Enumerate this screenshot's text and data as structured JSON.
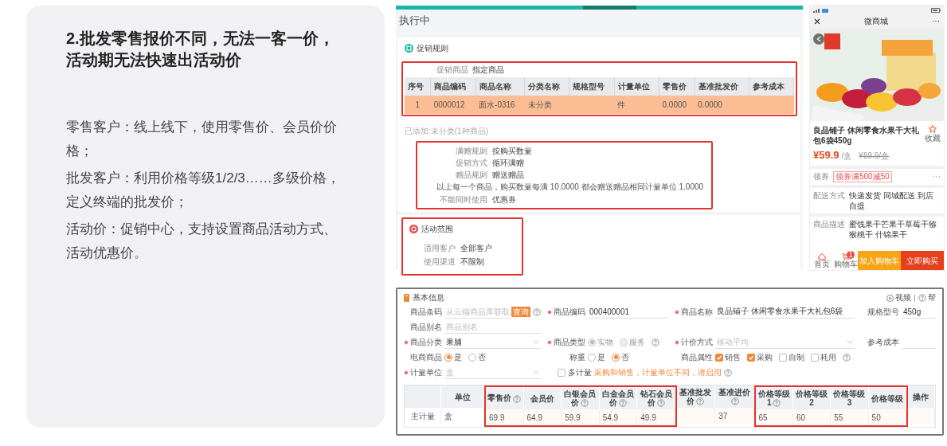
{
  "slide": {
    "title_lines": [
      "2.批发零售报价不同，无法一客一价，",
      "活动期无法快速出活动价"
    ],
    "paragraphs": [
      "零售客户：线上线下，使用零售价、会员价价格；",
      "批发客户：利用价格等级1/2/3……多级价格，定义终端的批发价；",
      "活动价：促销中心，支持设置商品活动方式、活动优惠价。"
    ]
  },
  "promo_screen": {
    "status": "执行中",
    "rule_section": {
      "title": "促销规则",
      "highlighted": true,
      "field": {
        "label": "促销商品",
        "value": "指定商品"
      },
      "columns": [
        "序号",
        "商品编码",
        "商品名称",
        "分类名称",
        "规格型号",
        "计量单位",
        "零售价",
        "基准批发价",
        "参考成本"
      ],
      "rows": [
        {
          "selected": true,
          "cells": [
            "1",
            "0000012",
            "面水-0316",
            "未分类",
            null,
            "件",
            "0.0000",
            "0.0000",
            null
          ]
        }
      ]
    },
    "added_note": "已添加:未分类(1种商品)",
    "rule_box": {
      "highlighted": true,
      "lines": [
        {
          "kind": "field",
          "label": "满赠规则",
          "value": "按购买数量"
        },
        {
          "kind": "field",
          "label": "促销方式",
          "value": "循环满赠"
        },
        {
          "kind": "field",
          "label": "赠品规则",
          "value": "赠送赠品"
        },
        {
          "kind": "sentence",
          "text": "以上每一个商品，购买数量每满 10.0000 都会赠送赠品相同计量单位 1.0000"
        },
        {
          "kind": "field",
          "label": "不能同时使用",
          "value": "优惠券"
        }
      ]
    },
    "scope_section": {
      "title": "活动范围",
      "highlighted": true,
      "fields": [
        {
          "label": "适用客户",
          "value": "全部客户"
        },
        {
          "label": "使用渠道",
          "value": "不限制"
        }
      ]
    }
  },
  "phone": {
    "title": "微商城",
    "menu": "···",
    "product_name": "良品铺子 休闲零食水果干大礼包6袋450g",
    "favorite": "收藏",
    "price": "¥59.9",
    "price_unit": "/盒",
    "old_price": "¥89.9/盒",
    "coupon": {
      "label": "领券",
      "tag": "领券满500减50",
      "more": "···"
    },
    "delivery": {
      "label": "配送方式",
      "value": "快递发货 同城配送 到店自提"
    },
    "description": {
      "label": "商品描述",
      "value": "蜜饯果干芒果干草莓干猕猴桃干 什锦果干"
    },
    "nav": [
      {
        "kind": "home",
        "label": "首页"
      },
      {
        "kind": "cart",
        "label": "购物车",
        "badge": "1"
      }
    ],
    "buttons": [
      {
        "kind": "cart",
        "label": "加入购物车"
      },
      {
        "kind": "buy",
        "label": "立即购买"
      }
    ]
  },
  "product_form": {
    "title": "基本信息",
    "links": [
      {
        "kind": "video",
        "label": "视频"
      },
      {
        "kind": "help",
        "label": "帮"
      }
    ],
    "rows": [
      [
        {
          "kind": "text",
          "label": "商品条码",
          "required": false,
          "help": true,
          "placeholder": "从云端商品库获取",
          "button": "查询"
        },
        {
          "kind": "text",
          "label": "商品编码",
          "required": true,
          "help": false,
          "value": "000400001"
        },
        {
          "kind": "text",
          "label": "商品名称",
          "required": true,
          "help": false,
          "value": "良品铺子 休闲零食水果干大礼包6袋"
        },
        {
          "kind": "text",
          "label": "规格型号",
          "required": false,
          "help": false,
          "value": "450g"
        }
      ],
      [
        {
          "kind": "text",
          "label": "商品别名",
          "required": false,
          "help": false,
          "placeholder": "商品别名"
        }
      ],
      [
        {
          "kind": "select",
          "label": "商品分类",
          "required": true,
          "help": false,
          "disabled": false,
          "value": "果脯"
        },
        {
          "kind": "radio",
          "label": "商品类型",
          "required": true,
          "help": true,
          "disabled": true,
          "options": [
            {
              "label": "实物",
              "selected": true
            },
            {
              "label": "服务",
              "selected": false
            }
          ]
        },
        {
          "kind": "select",
          "label": "计价方式",
          "required": true,
          "help": false,
          "disabled": false,
          "placeholder": "移动平均"
        },
        {
          "kind": "text",
          "label": "参考成本",
          "required": false,
          "help": false
        }
      ],
      [
        {
          "kind": "radio",
          "label": "电商商品",
          "required": false,
          "help": false,
          "disabled": false,
          "options": [
            {
              "label": "是",
              "selected": true
            },
            {
              "label": "否",
              "selected": false
            }
          ]
        },
        {
          "kind": "radio",
          "label": "称重",
          "required": false,
          "help": false,
          "disabled": false,
          "options": [
            {
              "label": "是",
              "selected": false
            },
            {
              "label": "否",
              "selected": true
            }
          ]
        },
        {
          "kind": "checks",
          "label": "商品属性",
          "required": false,
          "help": true,
          "options": [
            {
              "label": "销售",
              "checked": true
            },
            {
              "label": "采购",
              "checked": true
            },
            {
              "label": "自制",
              "checked": false
            },
            {
              "label": "耗用",
              "checked": false
            }
          ]
        }
      ],
      [
        {
          "kind": "select",
          "label": "计量单位",
          "required": true,
          "help": false,
          "disabled": true,
          "value": "盒"
        },
        {
          "kind": "checkbox",
          "label": "多计量",
          "checked": false,
          "wide": true,
          "help": true,
          "note": "采购和销售，计量单位不同，请启用"
        }
      ]
    ],
    "table": {
      "columns": [
        {
          "help": false,
          "highlighted": false
        },
        {
          "label": "单位",
          "help": false,
          "highlighted": false
        },
        {
          "label": "零售价",
          "help": true,
          "highlighted": true
        },
        {
          "label": "会员价",
          "help": false,
          "highlighted": true
        },
        {
          "label": "白银会员价",
          "help": true,
          "highlighted": true
        },
        {
          "label": "白金会员价",
          "help": true,
          "highlighted": true
        },
        {
          "label": "钻石会员价",
          "help": true,
          "highlighted": true
        },
        {
          "label": "基准批发价",
          "help": true,
          "highlighted": false
        },
        {
          "label": "基准进价",
          "help": true,
          "highlighted": false
        },
        {
          "label": "价格等级1",
          "help": true,
          "highlighted": true
        },
        {
          "label": "价格等级2",
          "help": false,
          "highlighted": true
        },
        {
          "label": "价格等级3",
          "help": false,
          "highlighted": true
        },
        {
          "label": "价格等级",
          "help": false,
          "highlighted": true
        },
        {
          "label": "操作",
          "help": false,
          "highlighted": false
        }
      ],
      "rows": [
        {
          "cells": [
            "主计量",
            "盒",
            "69.9",
            "64.9",
            "59.9",
            "54.9",
            "49.9",
            null,
            "37",
            "65",
            "60",
            "55",
            "50",
            null
          ]
        }
      ]
    }
  }
}
